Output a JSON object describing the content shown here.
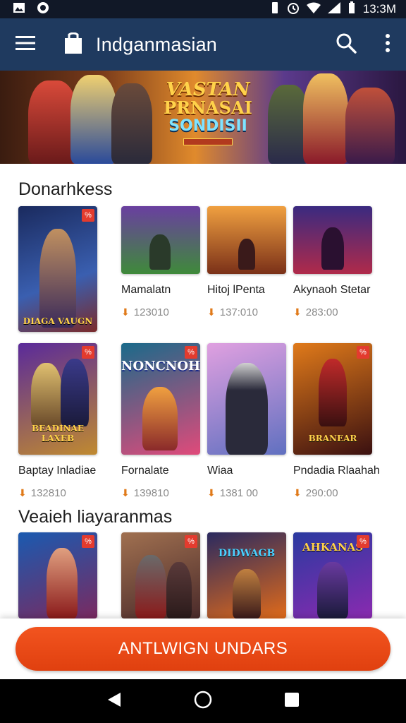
{
  "status_bar": {
    "time": "13:3M"
  },
  "app_bar": {
    "title": "Indganmasian"
  },
  "banner": {
    "line1": "VASTAN",
    "line2": "PRNASAI",
    "line3": "SONDISII"
  },
  "sections": [
    {
      "title": "Donarhkess",
      "cards": [
        {
          "name": "",
          "count": "",
          "caption": "DIAGA VAUGN",
          "colors": [
            "#1a2a5e",
            "#3a5fb0"
          ]
        },
        {
          "name": "Mamalatn",
          "count": "123010",
          "caption": "",
          "colors": [
            "#6a3fa0",
            "#3f8a3a"
          ]
        },
        {
          "name": "Hitoj lPenta",
          "count": "137:010",
          "caption": "",
          "colors": [
            "#f0a040",
            "#7a3018"
          ]
        },
        {
          "name": "Akynaoh Stetar",
          "count": "283:00",
          "caption": "",
          "colors": [
            "#3a2a80",
            "#b02a4a"
          ]
        }
      ]
    },
    {
      "title": "",
      "cards": [
        {
          "name": "Baptay Inladiae",
          "count": "132810",
          "caption": "BEADINAE LAXEB",
          "colors": [
            "#5a2a9a",
            "#c08a30"
          ]
        },
        {
          "name": "Fornalate",
          "count": "139810",
          "caption": "NONCNOH",
          "colors": [
            "#1a6a8a",
            "#e04a7a"
          ]
        },
        {
          "name": "Wiaa",
          "count": "1381 00",
          "caption": "",
          "colors": [
            "#e0a0e0",
            "#6070c0"
          ]
        },
        {
          "name": "Pndadia Rlaahah",
          "count": "290:00",
          "caption": "BRANEAR",
          "colors": [
            "#e07a1a",
            "#3a1010"
          ]
        }
      ]
    },
    {
      "title": "Veaieh liayaranmas",
      "cards": [
        {
          "caption": "",
          "colors": [
            "#1a5ab0",
            "#7a2a60"
          ]
        },
        {
          "caption": "",
          "colors": [
            "#a07050",
            "#4a2a2a"
          ]
        },
        {
          "caption": "DIDWAGB",
          "colors": [
            "#2a2a60",
            "#e06a1a"
          ]
        },
        {
          "caption": "AHKANAS",
          "colors": [
            "#2a3aa0",
            "#8a2ab0"
          ]
        }
      ]
    }
  ],
  "cta": {
    "label": "ANTLWIGN UNDARS"
  },
  "theme": {
    "app_bar": "#1f3a5f",
    "accent": "#e0400f",
    "badge": "#e33b2e"
  }
}
